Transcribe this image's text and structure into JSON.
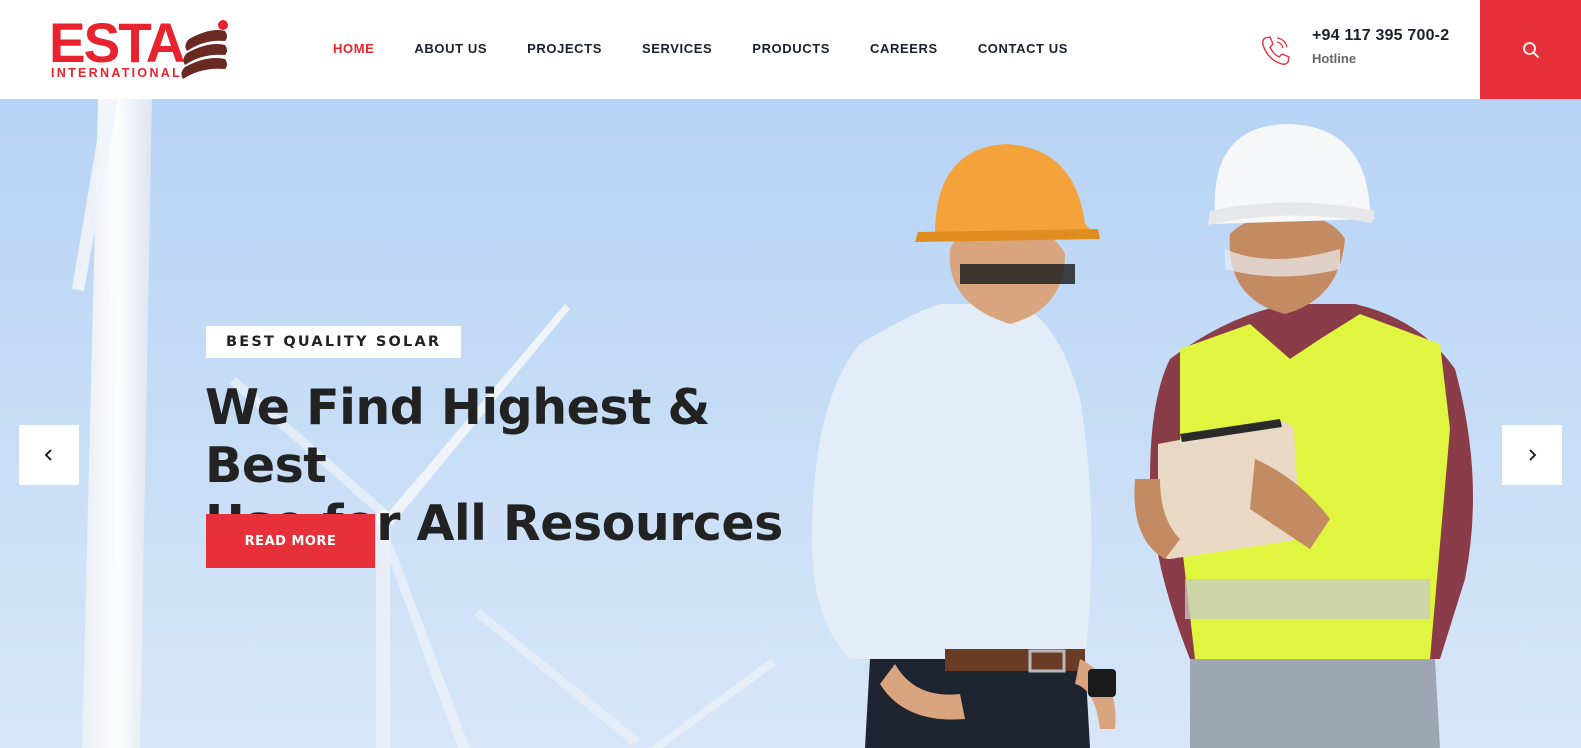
{
  "logo": {
    "name": "ESTA",
    "subtitle": "INTERNATIONAL",
    "brand_color": "#e8232d",
    "mark_color": "#6a2a22"
  },
  "nav": {
    "items": [
      {
        "label": "HOME",
        "active": true
      },
      {
        "label": "ABOUT US",
        "active": false
      },
      {
        "label": "PROJECTS",
        "active": false
      },
      {
        "label": "SERVICES",
        "active": false
      },
      {
        "label": "PRODUCTS",
        "active": false
      },
      {
        "label": "CAREERS",
        "active": false
      },
      {
        "label": "CONTACT US",
        "active": false
      }
    ]
  },
  "hotline": {
    "icon": "phone-icon",
    "number": "+94 117 395 700-2",
    "label": "Hotline"
  },
  "search": {
    "icon": "search-icon"
  },
  "hero": {
    "badge": "BEST QUALITY SOLAR",
    "title_line1": "We Find Highest & Best",
    "title_line2": "Use for All Resources",
    "button_label": "READ MORE",
    "prev_icon": "chevron-left-icon",
    "next_icon": "chevron-right-icon"
  },
  "colors": {
    "accent": "#e8303a",
    "text_dark": "#1b1f2b",
    "sky": "#c3dbf6"
  }
}
